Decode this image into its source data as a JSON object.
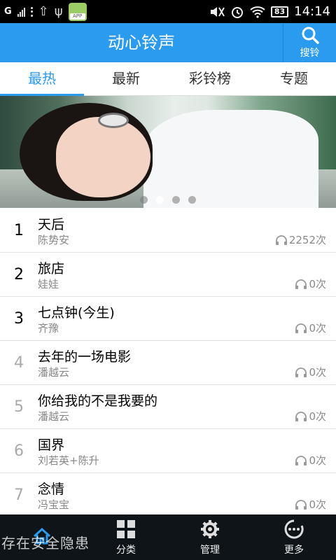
{
  "status_bar": {
    "network": "G",
    "app_badge": "APP",
    "battery": "83",
    "time": "14:14"
  },
  "header": {
    "title": "动心铃声",
    "search_label": "搜铃"
  },
  "tabs": [
    {
      "label": "最热",
      "active": true
    },
    {
      "label": "最新",
      "active": false
    },
    {
      "label": "彩铃榜",
      "active": false
    },
    {
      "label": "专题",
      "active": false
    }
  ],
  "banner": {
    "slide_count": 4,
    "active_slide": 2
  },
  "songs": [
    {
      "rank": "1",
      "title": "天后",
      "artist": "陈势安",
      "plays": "2252次"
    },
    {
      "rank": "2",
      "title": "旅店",
      "artist": "娃娃",
      "plays": "0次"
    },
    {
      "rank": "3",
      "title": "七点钟(今生)",
      "artist": "齐豫",
      "plays": "0次"
    },
    {
      "rank": "4",
      "title": "去年的一场电影",
      "artist": "潘越云",
      "plays": "0次"
    },
    {
      "rank": "5",
      "title": "你给我的不是我要的",
      "artist": "潘越云",
      "plays": "0次"
    },
    {
      "rank": "6",
      "title": "国界",
      "artist": "刘若英+陈升",
      "plays": "0次"
    },
    {
      "rank": "7",
      "title": "念情",
      "artist": "冯宝宝",
      "plays": "0次"
    }
  ],
  "bottom_nav": [
    {
      "label": "",
      "icon": "home-icon",
      "active": true
    },
    {
      "label": "分类",
      "icon": "grid-icon",
      "active": false
    },
    {
      "label": "管理",
      "icon": "gear-icon",
      "active": false
    },
    {
      "label": "更多",
      "icon": "more-icon",
      "active": false
    }
  ],
  "watermark": "存在安全隐患",
  "colors": {
    "accent": "#2b9bf0",
    "nav_bg": "#0f1419"
  }
}
